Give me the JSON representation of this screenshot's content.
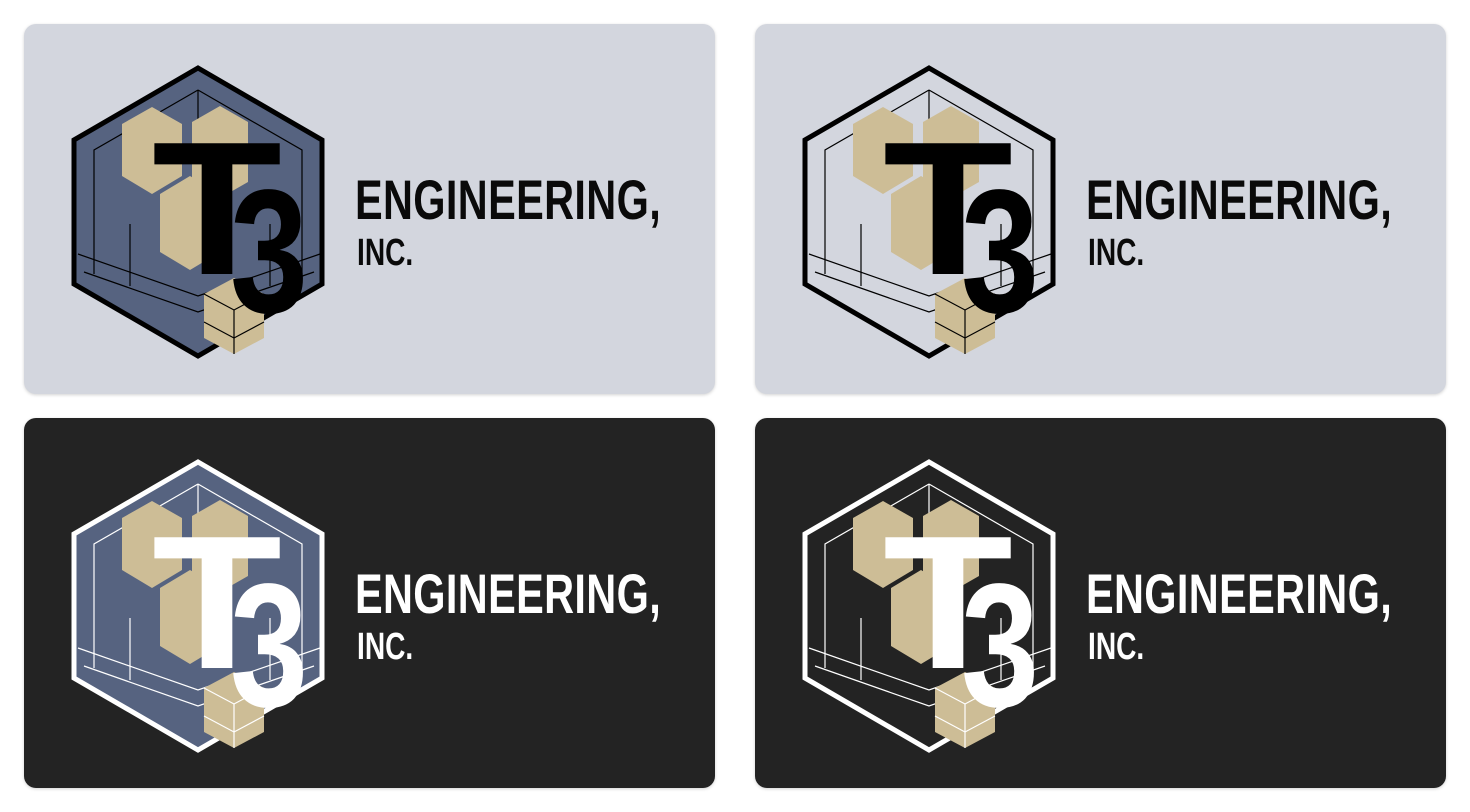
{
  "brand": {
    "monogram_t": "T",
    "monogram_3": "3",
    "name_line1": "ENGINEERING,",
    "name_line2": "INC."
  },
  "colors": {
    "light_background": "#d3d6de",
    "dark_background": "#232323",
    "navy": "#566380",
    "tan": "#cdbd96",
    "black": "#000000",
    "white": "#ffffff"
  },
  "variants": [
    {
      "theme": "light",
      "hexagon_fill": "navy"
    },
    {
      "theme": "light",
      "hexagon_fill": "none"
    },
    {
      "theme": "dark",
      "hexagon_fill": "navy"
    },
    {
      "theme": "dark",
      "hexagon_fill": "none"
    }
  ]
}
